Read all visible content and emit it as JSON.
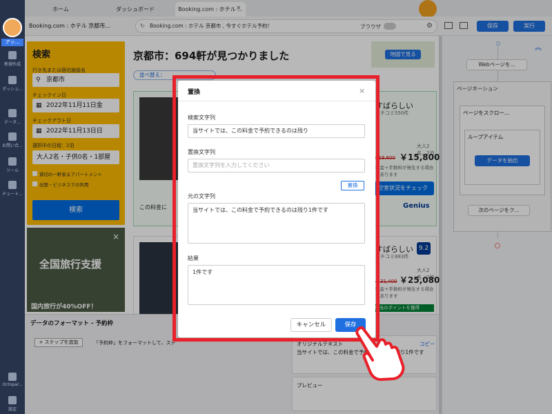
{
  "browser": {
    "tabs": [
      "ホーム",
      "ダッシュボード",
      "Booking.com : ホテル ..."
    ],
    "address": "Booking.com : ホテル 京都市 , 今すぐホテル予約!",
    "site_title": "Booking.com : ホテル 京都市...",
    "browser_label": "ブラウザ",
    "save_label": "保存",
    "run_label": "実行"
  },
  "sidebar": {
    "tag": "アッ...",
    "items": [
      "新規作成",
      "ダッシュ...",
      "データ...",
      "お問い合...",
      "ツール",
      "チュート..."
    ],
    "bottom": [
      "Octopar...",
      "設定"
    ]
  },
  "search": {
    "title": "検索",
    "dest_label": "行き先または宿泊施設名",
    "dest_value": "京都市",
    "checkin_label": "チェックイン日",
    "checkin_value": "2022年11月11日金",
    "checkout_label": "チェックアウト日",
    "checkout_value": "2022年11月13日日",
    "nights": "選択中の日程：2泊",
    "guests": "大人2名・子供0名・1部屋",
    "opt1": "貸切の一軒家＆アパートメント",
    "opt2": "出張・ビジネスでの利用",
    "button": "検索"
  },
  "ad": {
    "title": "全国旅行支援",
    "text": "国内旅行が40%OFF！"
  },
  "results": {
    "heading": "京都市：694軒が見つかりました",
    "map_button": "地図で見る",
    "sort": "並べ替え：",
    "card1": {
      "rating": "すばらしい",
      "reviews": "クチコミ550件",
      "guests": "大人2名、2泊",
      "old": "¥19,600",
      "price": "￥15,800",
      "note": "税金＋手数料が発生する場合があります",
      "cta": "空室状況をチェック",
      "banner": "この料金に",
      "genius": "Genius"
    },
    "card2": {
      "rating": "すばらしい",
      "reviews": "クチコミ883件",
      "score": "9.2",
      "guests": "大人2名、2泊",
      "old": "￥31,400",
      "price": "￥25,080",
      "note": "税金＋手数料が発生する場合があります",
      "points": "相当のポイントを獲得"
    }
  },
  "flow": {
    "nodes": [
      "Webページを...",
      "ページネーション",
      "ページをスクロー...",
      "ループアイテム",
      "データを抽出",
      "次のページをク..."
    ]
  },
  "bottom_panel": {
    "title": "データのフォーマット - 予約枠",
    "add_step": "+ ステップを追加",
    "desc": "「予約枠」をフォーマットして、ステップを追加してください",
    "orig_label": "オリジナルテキスト",
    "copy": "コピー",
    "orig_value": "当サイトでは、この料金で予約できるのは残り1件です",
    "preview": "プレビュー"
  },
  "modal": {
    "title": "置換",
    "search_label": "検索文字列",
    "search_value": "当サイトでは、この料金で予約できるのは残り",
    "replace_label": "置換文字列",
    "replace_placeholder": "置換文字列を入力してください",
    "replace_button": "置換",
    "original_label": "元の文字列",
    "original_value": "当サイトでは、この料金で予約できるのは残り1件です",
    "result_label": "結果",
    "result_value": "1件です",
    "cancel": "キャンセル",
    "save": "保存"
  },
  "colors": {
    "accent": "#1f6fe0",
    "highlight": "#e8202a",
    "booking_yellow": "#febb02",
    "booking_blue": "#006ce4"
  }
}
